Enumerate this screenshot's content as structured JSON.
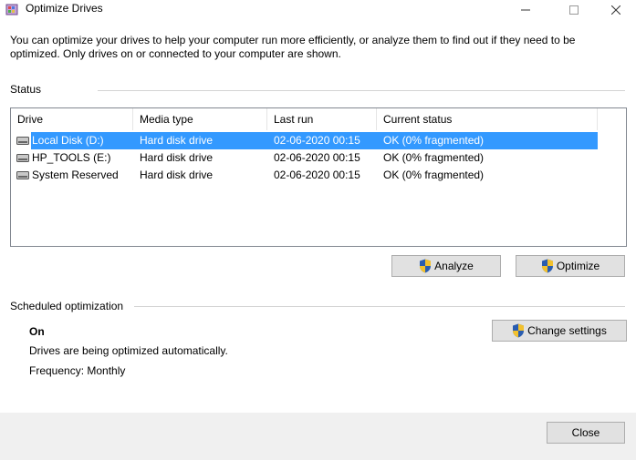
{
  "window": {
    "title": "Optimize Drives"
  },
  "intro_text": "You can optimize your drives to help your computer run more efficiently, or analyze them to find out if they need to be optimized. Only drives on or connected to your computer are shown.",
  "status": {
    "label": "Status",
    "columns": [
      "Drive",
      "Media type",
      "Last run",
      "Current status"
    ],
    "rows": [
      {
        "drive": "Local Disk (D:)",
        "media": "Hard disk drive",
        "last_run": "02-06-2020 00:15",
        "status": "OK (0% fragmented)"
      },
      {
        "drive": "HP_TOOLS (E:)",
        "media": "Hard disk drive",
        "last_run": "02-06-2020 00:15",
        "status": "OK (0% fragmented)"
      },
      {
        "drive": "System Reserved",
        "media": "Hard disk drive",
        "last_run": "02-06-2020 00:15",
        "status": "OK (0% fragmented)"
      }
    ],
    "selected_row": 0,
    "analyze_label": "Analyze",
    "optimize_label": "Optimize"
  },
  "scheduled": {
    "label": "Scheduled optimization",
    "state": "On",
    "description": "Drives are being optimized automatically.",
    "frequency": "Frequency: Monthly",
    "change_label": "Change settings"
  },
  "footer": {
    "close_label": "Close"
  },
  "icons": {
    "app": "defrag-app-icon",
    "drive": "hard-drive-icon",
    "shield": "uac-shield-icon"
  },
  "colors": {
    "selection": "#3399ff",
    "button_bg": "#e1e1e1",
    "footer_bg": "#f0f0f0"
  }
}
